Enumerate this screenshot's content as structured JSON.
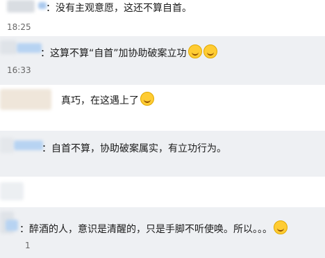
{
  "messages": [
    {
      "text": "：没有主观意愿，这还不算自首。",
      "time": "18:25"
    },
    {
      "text": "：这算不算“自首”加协助破案立功",
      "time": "16:33"
    },
    {
      "text": "真巧，在这遇上了"
    },
    {
      "text": "：自首不算，协助破案属实，有立功行为。"
    },
    {
      "text": "：醉酒的人，意识是清醒的，只是手脚不听使唤。所以。。。",
      "time": "1"
    }
  ],
  "emojis": [
    "grin-emoji",
    "yum-emoji",
    "laugh-emoji",
    "sweat-emoji"
  ]
}
